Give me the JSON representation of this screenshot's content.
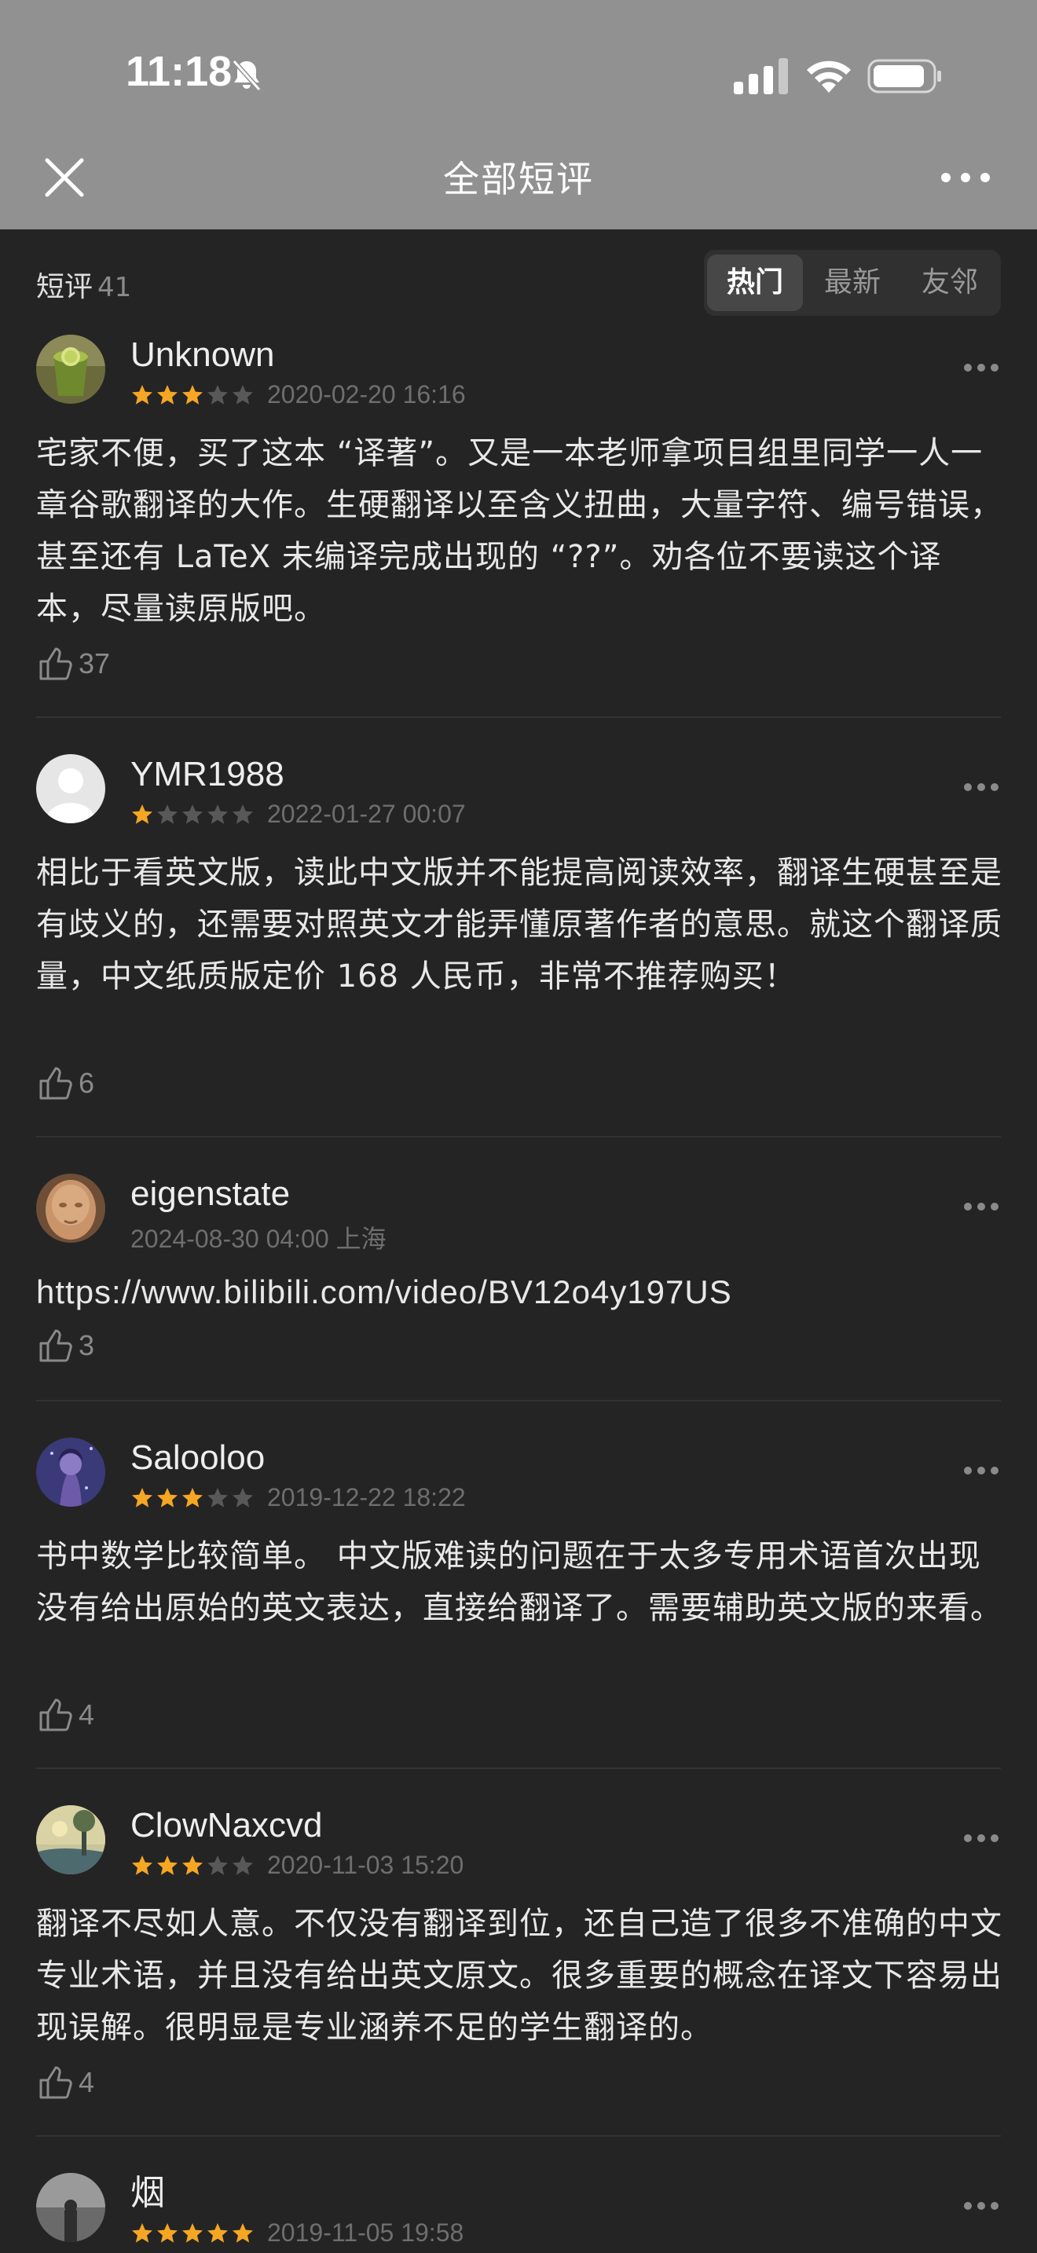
{
  "status_bar": {
    "time": "11:18",
    "icons": [
      "bell-slash-icon",
      "signal-icon",
      "wifi-icon",
      "battery-icon"
    ]
  },
  "nav": {
    "title": "全部短评",
    "close_icon": "close-icon",
    "more_icon": "more-icon"
  },
  "filter": {
    "label": "短评",
    "count": "41",
    "tabs": [
      {
        "label": "热门",
        "active": true
      },
      {
        "label": "最新",
        "active": false
      },
      {
        "label": "友邻",
        "active": false
      }
    ]
  },
  "colors": {
    "star_filled": "#F5A623",
    "star_empty": "#585858",
    "bg": "#242424",
    "top_bar": "#919191"
  },
  "reviews": [
    {
      "username": "Unknown",
      "rating": 3,
      "date": "2020-02-20 16:16",
      "text": "宅家不便，买了这本 “译著”。又是一本老师拿项目组里同学一人一章谷歌翻译的大作。生硬翻译以至含义扭曲，大量字符、编号错误，甚至还有 LaTeX 未编译完成出现的 “??”。劝各位不要读这个译本，尽量读原版吧。",
      "likes": "37"
    },
    {
      "username": "YMR1988",
      "rating": 1,
      "date": "2022-01-27 00:07",
      "text": "相比于看英文版，读此中文版并不能提高阅读效率，翻译生硬甚至是有歧义的，还需要对照英文才能弄懂原著作者的意思。就这个翻译质量，中文纸质版定价 168 人民币，非常不推荐购买！",
      "likes": "6"
    },
    {
      "username": "eigenstate",
      "rating": 0,
      "date": "2024-08-30 04:00 上海",
      "text": "https://www.bilibili.com/video/BV12o4y197US",
      "likes": "3"
    },
    {
      "username": "Salooloo",
      "rating": 3,
      "date": "2019-12-22 18:22",
      "text": "书中数学比较简单。 中文版难读的问题在于太多专用术语首次出现没有给出原始的英文表达，直接给翻译了。需要辅助英文版的来看。",
      "likes": "4"
    },
    {
      "username": "ClowNaxcvd",
      "rating": 3,
      "date": "2020-11-03 15:20",
      "text": "翻译不尽如人意。不仅没有翻译到位，还自己造了很多不准确的中文专业术语，并且没有给出英文原文。很多重要的概念在译文下容易出现误解。很明显是专业涵养不足的学生翻译的。",
      "likes": "4"
    },
    {
      "username": "烟",
      "rating": 5,
      "date": "2019-11-05 19:58"
    }
  ]
}
